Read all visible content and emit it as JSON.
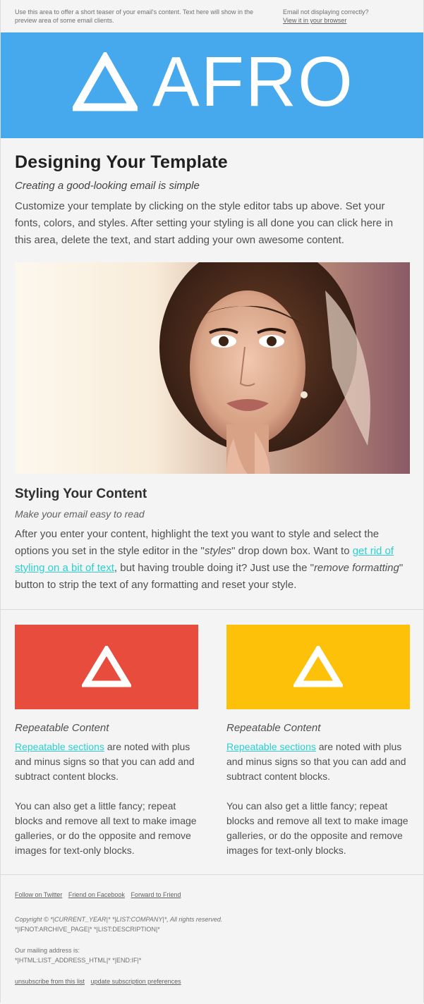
{
  "preheader": {
    "teaser": "Use this area to offer a short teaser of your email's content. Text here will show in the preview area of some email clients.",
    "not_displaying": "Email not displaying correctly?",
    "view_browser": "View it in your browser"
  },
  "header": {
    "brand_color": "#47a9ed",
    "logo_text": "AFRO"
  },
  "intro": {
    "title": "Designing Your Template",
    "subtitle": "Creating a good-looking email is simple",
    "body": "Customize your template by clicking on the style editor tabs up above. Set your fonts, colors, and styles. After setting your styling is all done you can click here in this area, delete the text, and start adding your own awesome content."
  },
  "styling": {
    "title": "Styling Your Content",
    "subtitle": "Make your email easy to read",
    "body_1": "After you enter your content, highlight the text you want to style and select the options you set in the style editor in the \"",
    "body_styles": "styles",
    "body_2": "\" drop down box. Want to ",
    "link": "get rid of styling on a bit of text",
    "body_3": ", but having trouble doing it? Just use the \"",
    "body_remove": "remove formatting",
    "body_4": "\" button to strip the text of any formatting and reset your style.",
    "link_color": "#2bd0d0"
  },
  "columns": [
    {
      "tile_color": "#e84c3d",
      "title": "Repeatable Content",
      "link": "Repeatable sections",
      "text_1": " are noted with plus and minus signs so that you can add and subtract content blocks.",
      "text_2": "You can also get a little fancy; repeat blocks and remove all text to make image galleries, or do the opposite and remove images for text-only blocks."
    },
    {
      "tile_color": "#fec109",
      "title": "Repeatable Content",
      "link": "Repeatable sections",
      "text_1": " are noted with plus and minus signs so that you can add and subtract content blocks.",
      "text_2": "You can also get a little fancy; repeat blocks and remove all text to make image galleries, or do the opposite and remove images for text-only blocks."
    }
  ],
  "footer": {
    "links": [
      "Follow on Twitter",
      "Friend on Facebook",
      "Forward to Friend"
    ],
    "copyright": "Copyright © *|CURRENT_YEAR|* *|LIST:COMPANY|*, All rights reserved.",
    "archive": "*|IFNOT:ARCHIVE_PAGE|* *|LIST:DESCRIPTION|*",
    "mailing_label": "Our mailing address is:",
    "address": "*|HTML:LIST_ADDRESS_HTML|* *|END:IF|*",
    "unsubscribe": "unsubscribe from this list",
    "update_prefs": "update subscription preferences"
  }
}
